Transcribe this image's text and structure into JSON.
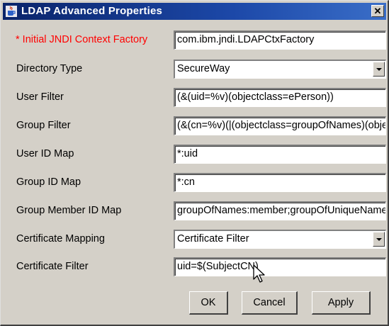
{
  "window": {
    "title": "LDAP Advanced Properties",
    "close_glyph": "✕"
  },
  "fields": [
    {
      "label": "* Initial JNDI Context Factory",
      "type": "text",
      "value": "com.ibm.jndi.LDAPCtxFactory",
      "required": true
    },
    {
      "label": "Directory Type",
      "type": "select",
      "value": "SecureWay"
    },
    {
      "label": "User Filter",
      "type": "text",
      "value": "(&(uid=%v)(objectclass=ePerson))"
    },
    {
      "label": "Group Filter",
      "type": "text",
      "value": "(&(cn=%v)(|(objectclass=groupOfNames)(objectclass=groupOfUniqueNames)))"
    },
    {
      "label": "User ID Map",
      "type": "text",
      "value": "*:uid"
    },
    {
      "label": "Group ID Map",
      "type": "text",
      "value": "*:cn"
    },
    {
      "label": "Group Member ID Map",
      "type": "text",
      "value": "groupOfNames:member;groupOfUniqueNames:uniqueMember"
    },
    {
      "label": "Certificate Mapping",
      "type": "select",
      "value": "Certificate Filter"
    },
    {
      "label": "Certificate Filter",
      "type": "text",
      "value": "uid=$(SubjectCN)"
    }
  ],
  "buttons": {
    "ok": "OK",
    "cancel": "Cancel",
    "apply": "Apply"
  },
  "colors": {
    "required_label": "#ff0000",
    "titlebar": "#0a246a",
    "window_bg": "#d4d0c8"
  },
  "icons": {
    "title": "java-cup-icon",
    "close": "close-icon",
    "dropdown": "chevron-down-icon",
    "cursor": "mouse-pointer-icon"
  }
}
